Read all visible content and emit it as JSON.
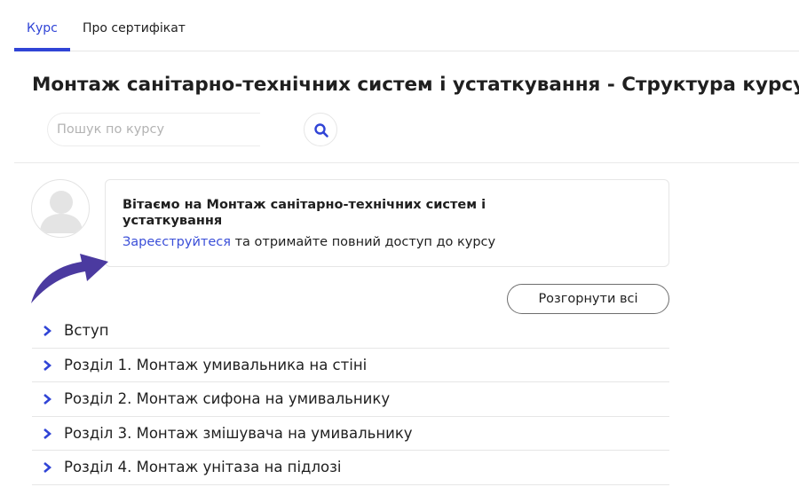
{
  "tabs": [
    {
      "label": "Курс",
      "active": true
    },
    {
      "label": "Про сертифікат",
      "active": false
    }
  ],
  "page_title": "Монтаж санітарно-технічних систем і устаткування - Структура курсу",
  "search": {
    "placeholder": "Пошук по курсу",
    "value": "",
    "icon": "search-icon"
  },
  "welcome": {
    "title": "Вітаємо на Монтаж санітарно-технічних систем і устаткування",
    "register_link": "Зареєструйтеся",
    "register_text": " та отримайте повний доступ до курсу"
  },
  "expand_all_label": "Розгорнути всі",
  "sections": [
    {
      "label": "Вступ"
    },
    {
      "label": "Розділ 1. Монтаж умивальника на стіні"
    },
    {
      "label": "Розділ 2. Монтаж сифона на умивальнику"
    },
    {
      "label": "Розділ 3. Монтаж змішувача на умивальнику"
    },
    {
      "label": "Розділ 4. Монтаж унітаза на підлозі"
    }
  ],
  "colors": {
    "accent": "#3044d6",
    "link": "#3b4fd8",
    "arrow": "#4b3aa0",
    "text": "#1f1f1f"
  }
}
